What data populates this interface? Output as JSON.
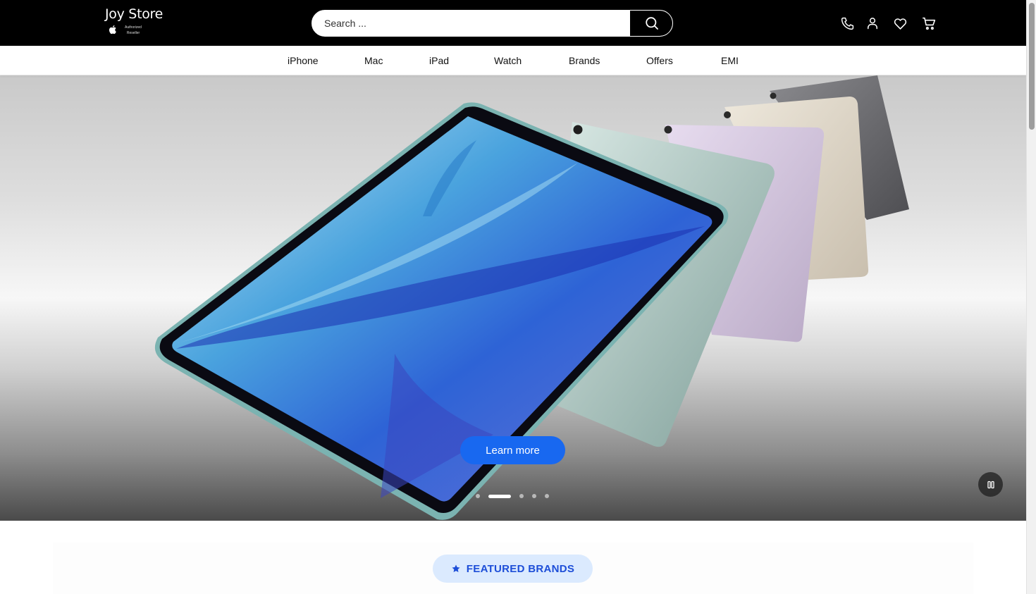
{
  "header": {
    "logo": {
      "name": "Joy Store",
      "tagline_line1": "Authorized",
      "tagline_line2": "Reseller"
    },
    "search": {
      "placeholder": "Search ..."
    },
    "icons": [
      "phone-icon",
      "user-icon",
      "heart-icon",
      "cart-icon"
    ]
  },
  "nav": {
    "items": [
      {
        "label": "iPhone"
      },
      {
        "label": "Mac"
      },
      {
        "label": "iPad"
      },
      {
        "label": "Watch"
      },
      {
        "label": "Brands"
      },
      {
        "label": "Offers"
      },
      {
        "label": "EMI"
      }
    ]
  },
  "hero": {
    "cta_label": "Learn more",
    "slide_count": 5,
    "active_slide": 2,
    "cta_color": "#1868f0"
  },
  "featured": {
    "label": "FEATURED BRANDS",
    "color": "#1d4ed8"
  },
  "colors": {
    "header_bg": "#000000",
    "accent": "#1868f0",
    "pill_bg": "#dbeafe"
  }
}
